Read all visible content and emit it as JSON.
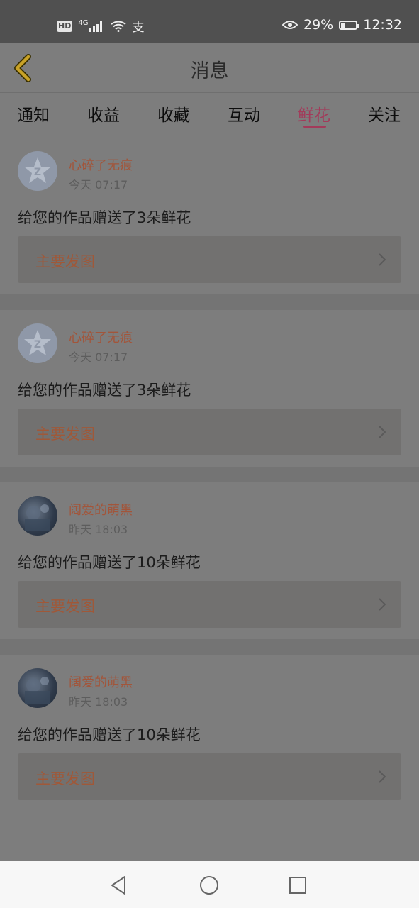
{
  "status": {
    "hd": "HD",
    "network": "4G",
    "extra_glyph": "支",
    "battery_percent": "29%",
    "battery_level": 0.29,
    "time": "12:32"
  },
  "header": {
    "title": "消息"
  },
  "tabs": [
    {
      "label": "通知"
    },
    {
      "label": "收益"
    },
    {
      "label": "收藏"
    },
    {
      "label": "互动"
    },
    {
      "label": "鲜花"
    },
    {
      "label": "关注"
    }
  ],
  "active_tab": "鲜花",
  "messages": [
    {
      "user": "心碎了无痕",
      "time": "今天 07:17",
      "text": "给您的作品赠送了3朵鲜花",
      "work": "主要发图",
      "avatar": "default-avatar"
    },
    {
      "user": "心碎了无痕",
      "time": "今天 07:17",
      "text": "给您的作品赠送了3朵鲜花",
      "work": "主要发图",
      "avatar": "default-avatar"
    },
    {
      "user": "阔爱的萌黑",
      "time": "昨天 18:03",
      "text": "给您的作品赠送了10朵鲜花",
      "work": "主要发图",
      "avatar": "photo-avatar"
    },
    {
      "user": "阔爱的萌黑",
      "time": "昨天 18:03",
      "text": "给您的作品赠送了10朵鲜花",
      "work": "主要发图",
      "avatar": "photo-avatar"
    }
  ],
  "icons": {
    "back": "back-arrow-icon",
    "chevron": "chevron-right-icon",
    "nav": [
      "nav-back-icon",
      "nav-home-icon",
      "nav-recents-icon"
    ]
  },
  "colors": {
    "accent": "#a33a5a",
    "username": "#a2553a",
    "back_arrow": "#c9a227"
  }
}
